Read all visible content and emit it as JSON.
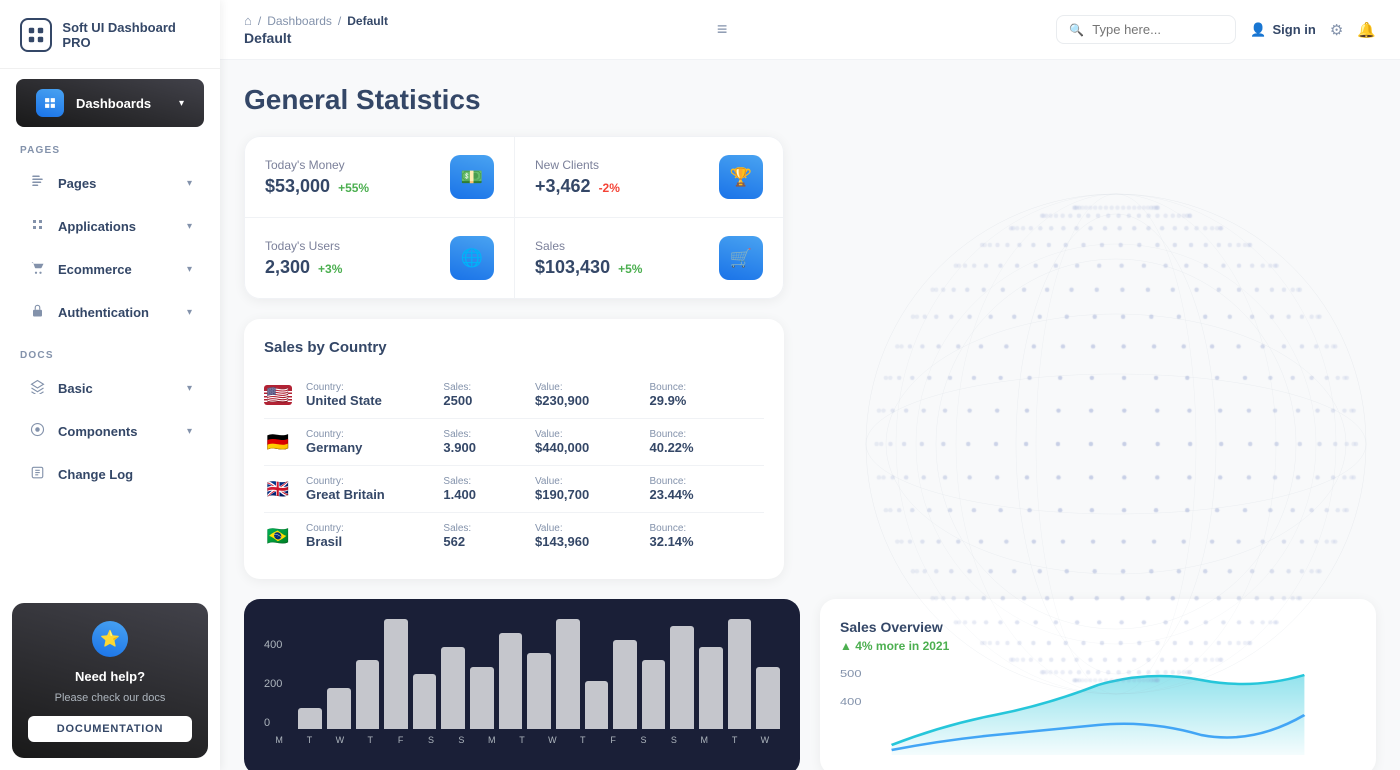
{
  "app": {
    "name": "Soft UI Dashboard PRO"
  },
  "sidebar": {
    "logo_text": "Soft UI Dashboard PRO",
    "section_pages": "PAGES",
    "section_docs": "DOCS",
    "items_pages": [
      {
        "id": "dashboards",
        "label": "Dashboards",
        "active": true
      },
      {
        "id": "pages",
        "label": "Pages",
        "active": false
      },
      {
        "id": "applications",
        "label": "Applications",
        "active": false
      },
      {
        "id": "ecommerce",
        "label": "Ecommerce",
        "active": false
      },
      {
        "id": "authentication",
        "label": "Authentication",
        "active": false
      }
    ],
    "items_docs": [
      {
        "id": "basic",
        "label": "Basic",
        "active": false
      },
      {
        "id": "components",
        "label": "Components",
        "active": false
      },
      {
        "id": "changelog",
        "label": "Change Log",
        "active": false
      }
    ]
  },
  "help_box": {
    "title": "Need help?",
    "subtitle": "Please check our docs",
    "button_label": "DOCUMENTATION"
  },
  "header": {
    "breadcrumb_home": "🏠",
    "breadcrumb_dashboards": "Dashboards",
    "breadcrumb_current": "Default",
    "page_title": "Default",
    "search_placeholder": "Type here...",
    "sign_in_label": "Sign in"
  },
  "page": {
    "title": "General Statistics"
  },
  "stats": [
    {
      "label": "Today's Money",
      "value": "$53,000",
      "change": "+55%",
      "change_type": "positive",
      "icon": "💵"
    },
    {
      "label": "New Clients",
      "value": "+3,462",
      "change": "-2%",
      "change_type": "negative",
      "icon": "🏆"
    },
    {
      "label": "Today's Users",
      "value": "2,300",
      "change": "+3%",
      "change_type": "positive",
      "icon": "🌐"
    },
    {
      "label": "Sales",
      "value": "$103,430",
      "change": "+5%",
      "change_type": "positive",
      "icon": "🛒"
    }
  ],
  "sales_by_country": {
    "title": "Sales by Country",
    "columns": [
      "Country:",
      "Sales:",
      "Value:",
      "Bounce:"
    ],
    "rows": [
      {
        "flag": "us",
        "country": "United State",
        "sales": "2500",
        "value": "$230,900",
        "bounce": "29.9%"
      },
      {
        "flag": "de",
        "country": "Germany",
        "sales": "3.900",
        "value": "$440,000",
        "bounce": "40.22%"
      },
      {
        "flag": "gb",
        "country": "Great Britain",
        "sales": "1.400",
        "value": "$190,700",
        "bounce": "23.44%"
      },
      {
        "flag": "br",
        "country": "Brasil",
        "sales": "562",
        "value": "$143,960",
        "bounce": "32.14%"
      }
    ]
  },
  "bar_chart": {
    "y_labels": [
      "400",
      "200",
      "0"
    ],
    "bars": [
      15,
      30,
      50,
      80,
      40,
      60,
      45,
      70,
      55,
      80,
      35,
      65,
      50,
      75,
      60,
      80,
      45
    ],
    "x_labels": [
      "M",
      "T",
      "W",
      "T",
      "F",
      "S",
      "S",
      "M",
      "T",
      "W",
      "T",
      "F",
      "S",
      "S",
      "M",
      "T",
      "W"
    ]
  },
  "sales_overview": {
    "title": "Sales Overview",
    "change_text": "4% more in 2021",
    "y_labels": [
      "500",
      "400"
    ]
  }
}
